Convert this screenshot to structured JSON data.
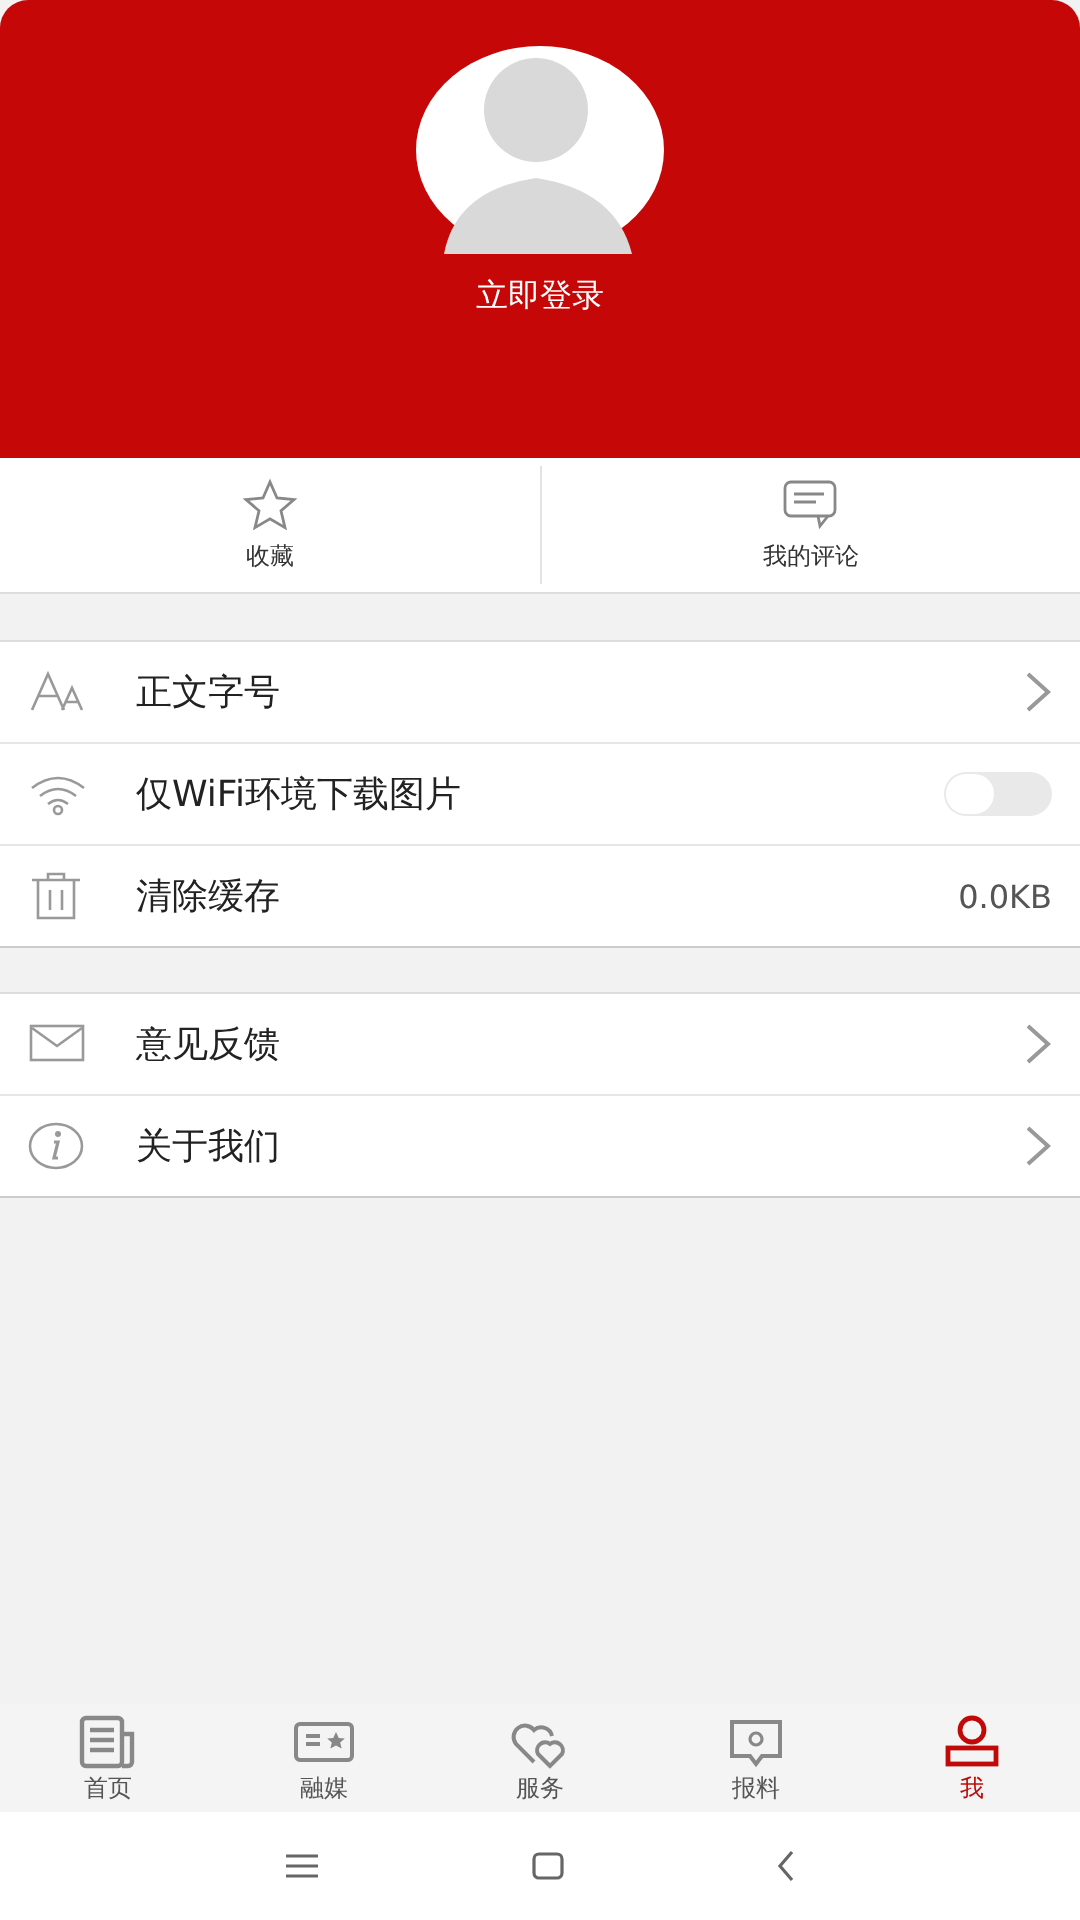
{
  "profile": {
    "login_label": "立即登录"
  },
  "shortcuts": [
    {
      "label": "收藏"
    },
    {
      "label": "我的评论"
    }
  ],
  "settings_groups": [
    [
      {
        "kind": "arrow",
        "label": "正文字号"
      },
      {
        "kind": "toggle",
        "label": "仅WiFi环境下载图片",
        "on": false
      },
      {
        "kind": "value",
        "label": "清除缓存",
        "value": "0.0KB"
      }
    ],
    [
      {
        "kind": "arrow",
        "label": "意见反馈"
      },
      {
        "kind": "arrow",
        "label": "关于我们"
      }
    ]
  ],
  "tabs": [
    {
      "label": "首页",
      "selected": false
    },
    {
      "label": "融媒",
      "selected": false
    },
    {
      "label": "服务",
      "selected": false
    },
    {
      "label": "报料",
      "selected": false
    },
    {
      "label": "我",
      "selected": true
    }
  ]
}
